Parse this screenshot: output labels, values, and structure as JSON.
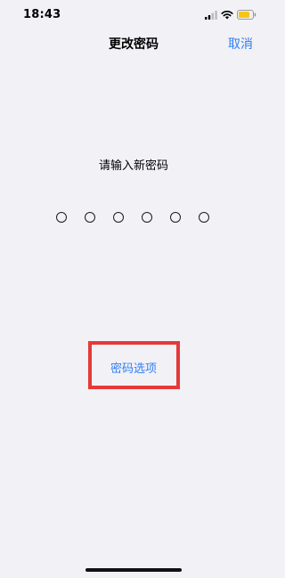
{
  "status_bar": {
    "time": "18:43",
    "icons": [
      "signal-icon",
      "wifi-icon",
      "battery-icon"
    ],
    "battery_color": "#f5c518"
  },
  "nav": {
    "title": "更改密码",
    "cancel_label": "取消"
  },
  "main": {
    "prompt": "请输入新密码",
    "passcode_length": 6,
    "options_label": "密码选项"
  },
  "colors": {
    "background": "#f2f1f6",
    "accent": "#2f7ff5",
    "highlight_border": "#e63939"
  }
}
